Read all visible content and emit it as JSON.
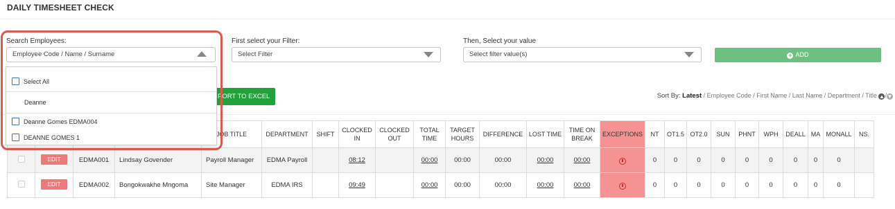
{
  "page": {
    "title": "DAILY TIMESHEET CHECK"
  },
  "filters": {
    "search_label": "Search Employees:",
    "search_placeholder": "Employee Code / Name / Surname",
    "filter_label": "First select your Filter:",
    "filter_placeholder": "Select Filter",
    "value_label": "Then, Select your value",
    "value_placeholder": "Select filter value(s)",
    "add_label": "ADD"
  },
  "dropdown": {
    "select_all": "Select All",
    "search_text": "Deanne",
    "options": [
      "Deanne Gomes EDMA004",
      "DEANNE GOMES 1"
    ]
  },
  "toolbar": {
    "export_label": "PORT TO EXCEL",
    "sort_prefix": "Sort By:",
    "sort_options": [
      "Latest",
      "Employee Code",
      "First Name",
      "Last Name",
      "Department",
      "Title"
    ],
    "sort_separator": " / "
  },
  "table": {
    "headers": [
      "",
      "",
      "",
      "",
      "JOB TITLE",
      "DEPARTMENT",
      "SHIFT",
      "CLOCKED IN",
      "CLOCKED OUT",
      "TOTAL TIME",
      "TARGET HOURS",
      "DIFFERENCE",
      "LOST TIME",
      "TIME ON BREAK",
      "EXCEPTIONS",
      "NT",
      "OT1.5",
      "OT2.0",
      "SUN",
      "PHNT",
      "WPH",
      "DEALL",
      "MA",
      "MONALL",
      "NS."
    ],
    "edit_label": "EDIT",
    "rows": [
      {
        "code": "EDMA001",
        "name": "Lindsay Govender",
        "job_title": "Payroll Manager",
        "department": "EDMA Payroll",
        "shift": "",
        "clocked_in": "08:12",
        "clocked_out": "",
        "total_time": "00:00",
        "target_hours": "00:00",
        "difference": "00:00",
        "lost_time": "00:00",
        "time_on_break": "00:00",
        "nt": "0",
        "ot15": "0",
        "ot20": "0",
        "sun": "0",
        "phnt": "0",
        "wph": "0",
        "deall": "0",
        "ma": "0",
        "monall": "0"
      },
      {
        "code": "EDMA002",
        "name": "Bongokwakhe Mngoma",
        "job_title": "Site Manager",
        "department": "EDMA IRS",
        "shift": "",
        "clocked_in": "09:49",
        "clocked_out": "",
        "total_time": "00:00",
        "target_hours": "00:00",
        "difference": "00:00",
        "lost_time": "00:00",
        "time_on_break": "00:00",
        "nt": "0",
        "ot15": "0",
        "ot20": "0",
        "sun": "0",
        "phnt": "0",
        "wph": "0",
        "deall": "0",
        "ma": "0",
        "monall": "0"
      }
    ]
  },
  "colors": {
    "add_button": "#6cc080",
    "export_button": "#21a23b",
    "edit_button": "#ec7a7a",
    "exception_cell": "#f59393",
    "highlight_ring": "#e0584a",
    "checkbox_border": "#3b76c4"
  }
}
